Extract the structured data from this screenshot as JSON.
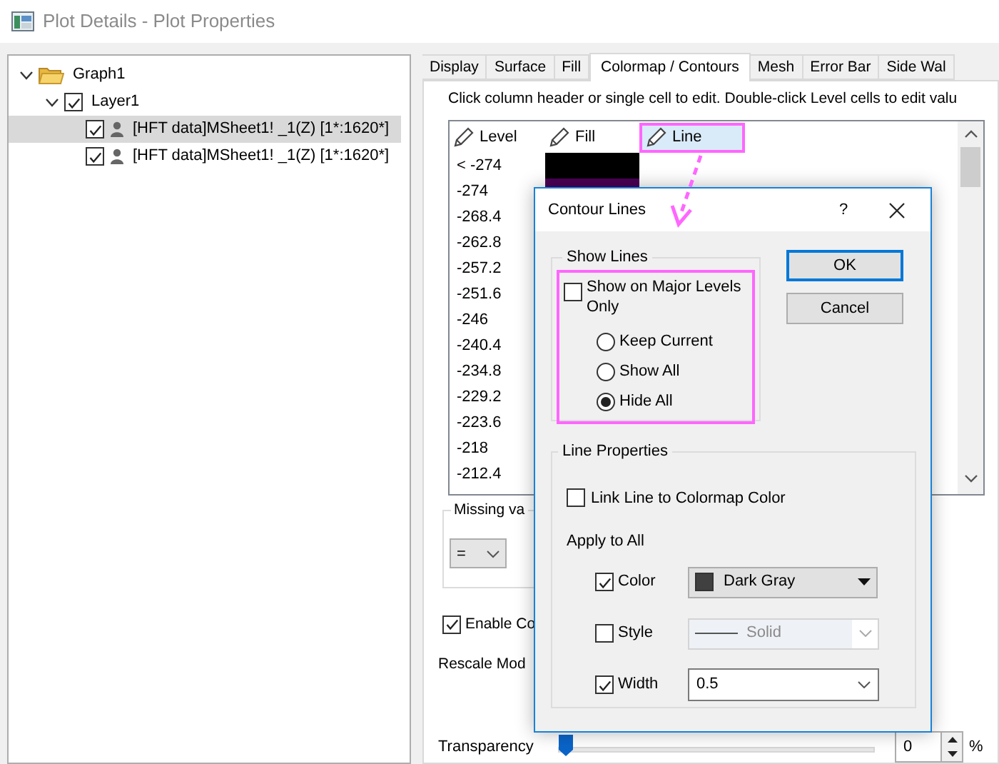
{
  "window": {
    "title": "Plot Details - Plot Properties"
  },
  "tree": [
    {
      "label": "Graph1",
      "expanded": true,
      "children": [
        {
          "label": "Layer1",
          "expanded": true,
          "checked": true,
          "children": [
            {
              "label": "[HFT data]MSheet1! _1(Z) [1*:1620*]",
              "checked": true,
              "selected": true
            },
            {
              "label": "[HFT data]MSheet1! _1(Z) [1*:1620*]",
              "checked": true,
              "selected": false
            }
          ]
        }
      ]
    }
  ],
  "tabs": [
    {
      "label": "Display",
      "selected": false
    },
    {
      "label": "Surface",
      "selected": false
    },
    {
      "label": "Fill",
      "selected": false
    },
    {
      "label": "Colormap / Contours",
      "selected": true
    },
    {
      "label": "Mesh",
      "selected": false
    },
    {
      "label": "Error Bar",
      "selected": false
    },
    {
      "label": "Side Wal",
      "selected": false
    }
  ],
  "instruction": "Click column header or single cell to edit. Double-click Level cells to edit valu",
  "level_table": {
    "columns": [
      {
        "label": "Level",
        "selected": false
      },
      {
        "label": "Fill",
        "selected": false
      },
      {
        "label": "Line",
        "selected": true
      }
    ],
    "rows": [
      {
        "level": "< -274",
        "color": "#000000"
      },
      {
        "level": "-274",
        "color": "#4b0055"
      },
      {
        "level": "-268.4"
      },
      {
        "level": "-262.8"
      },
      {
        "level": "-257.2"
      },
      {
        "level": "-251.6"
      },
      {
        "level": "-246"
      },
      {
        "level": "-240.4"
      },
      {
        "level": "-234.8"
      },
      {
        "level": "-229.2"
      },
      {
        "level": "-223.6"
      },
      {
        "level": "-218"
      },
      {
        "level": "-212.4"
      }
    ]
  },
  "missing_values": {
    "title": "Missing va",
    "operator": "="
  },
  "enable": {
    "label": "Enable Co",
    "checked": true
  },
  "rescale": {
    "label": "Rescale Mod"
  },
  "transparency": {
    "label": "Transparency",
    "level": 0,
    "value": "0",
    "unit": "%"
  },
  "dialog": {
    "title": "Contour Lines",
    "help": "?",
    "show_lines": {
      "title": "Show Lines",
      "major_only": {
        "label": "Show on Major Levels Only",
        "checked": false
      },
      "options": [
        {
          "label": "Keep Current",
          "selected": false
        },
        {
          "label": "Show All",
          "selected": false
        },
        {
          "label": "Hide All",
          "selected": true
        }
      ]
    },
    "buttons": [
      {
        "label": "OK",
        "default": true
      },
      {
        "label": "Cancel",
        "default": false
      }
    ],
    "line_properties": {
      "title": "Line Properties",
      "link": {
        "label": "Link Line to Colormap Color",
        "checked": false
      },
      "apply_label": "Apply to All",
      "rows": [
        {
          "kind": "color",
          "label": "Color",
          "checked": true,
          "value": "Dark Gray",
          "color": "#404040"
        },
        {
          "kind": "style",
          "label": "Style",
          "checked": false,
          "value": "Solid",
          "disabled": true
        },
        {
          "kind": "width",
          "label": "Width",
          "checked": true,
          "value": "0.5"
        }
      ]
    }
  }
}
